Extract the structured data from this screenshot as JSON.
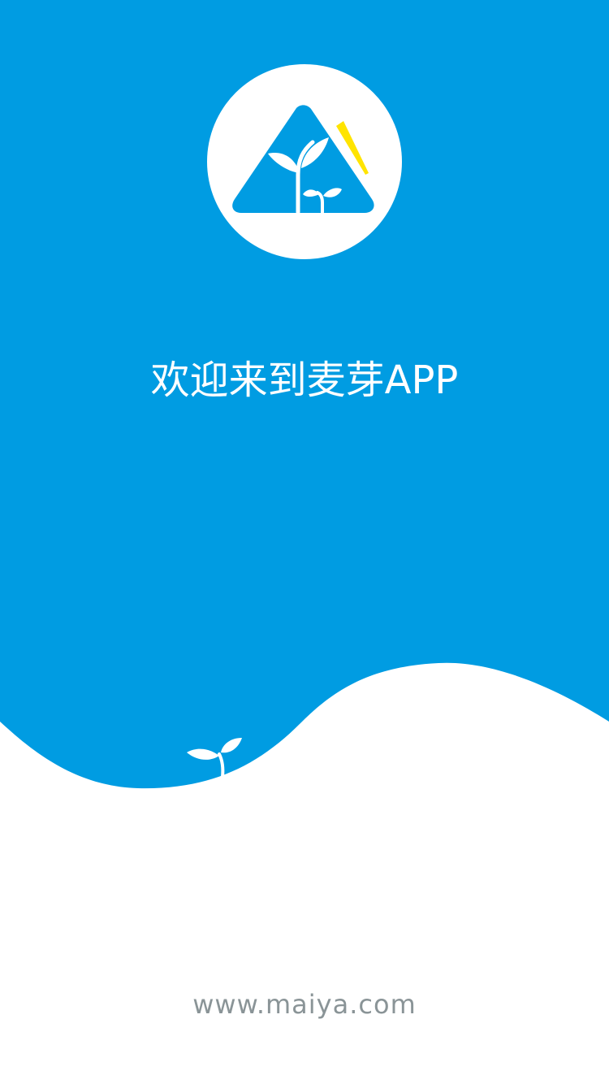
{
  "theme": {
    "primary_color": "#009CE2",
    "background_color": "#FFFFFF",
    "accent_color": "#FFE400",
    "url_text_color": "#8A9497"
  },
  "logo": {
    "icon": "sprout-mountain-logo-icon"
  },
  "welcome": {
    "title": "欢迎来到麦芽APP"
  },
  "decoration": {
    "icon": "sprout-icon"
  },
  "footer": {
    "website": "www.maiya.com"
  }
}
